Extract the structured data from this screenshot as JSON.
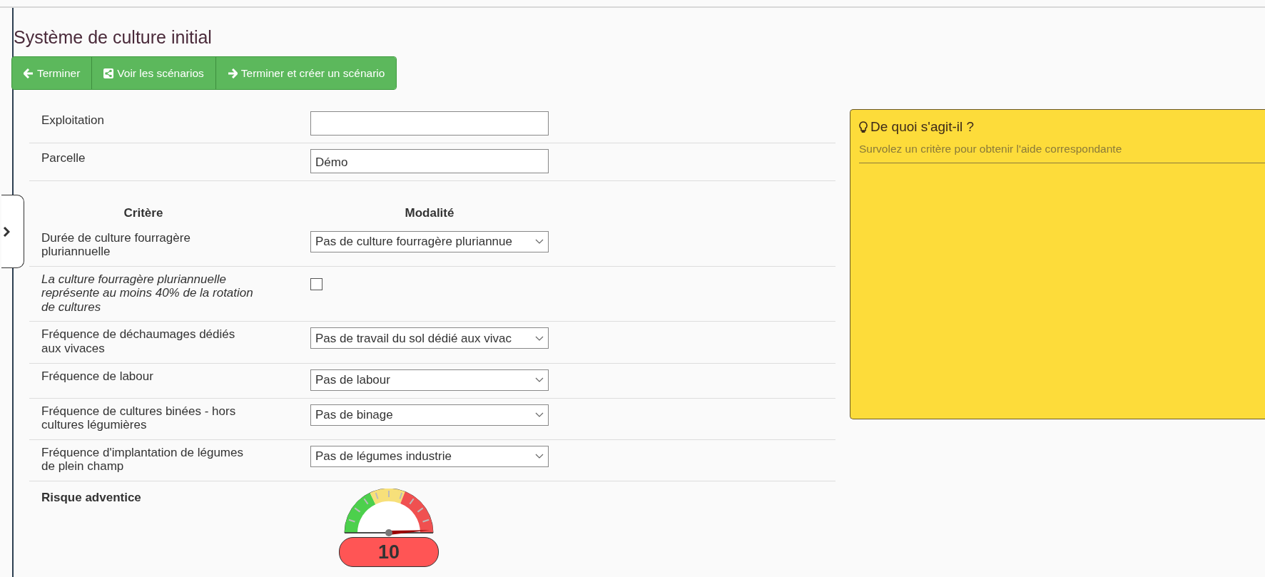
{
  "page": {
    "title": "Système de culture initial"
  },
  "toolbar": [
    {
      "kind": "back",
      "label": "Terminer"
    },
    {
      "kind": "share",
      "label": "Voir les scénarios"
    },
    {
      "kind": "forward",
      "label": "Terminer et créer un scénario"
    }
  ],
  "sidebar_toggle": {
    "expanded": false
  },
  "fields": [
    {
      "label": "Exploitation"
    },
    {
      "label": "Parcelle",
      "value": "Démo"
    }
  ],
  "criteria_table": {
    "columns": [
      "Critère",
      "Modalité"
    ],
    "rows": [
      {
        "kind": "select",
        "label": "Durée de culture fourragère pluriannuelle",
        "value": "Pas de culture fourragère pluriannue"
      },
      {
        "kind": "checkbox",
        "label": "La culture fourragère pluriannuelle représente au moins 40% de la rotation de cultures",
        "checked": false
      },
      {
        "kind": "select",
        "label": "Fréquence de déchaumages dédiés aux vivaces",
        "value": "Pas de travail du sol dédié aux vivac"
      },
      {
        "kind": "select",
        "label": "Fréquence de labour",
        "value": "Pas de labour"
      },
      {
        "kind": "select",
        "label": "Fréquence de cultures binées - hors cultures légumières",
        "value": "Pas de binage"
      },
      {
        "kind": "select",
        "label": "Fréquence d'implantation de légumes de plein champ",
        "value": "Pas de légumes industrie"
      }
    ]
  },
  "result": {
    "label": "Risque adventice",
    "reading": "10"
  },
  "help": {
    "title": "De quoi s'agit-il ?",
    "text": "Survolez un critère pour obtenir l'aide correspondante"
  }
}
